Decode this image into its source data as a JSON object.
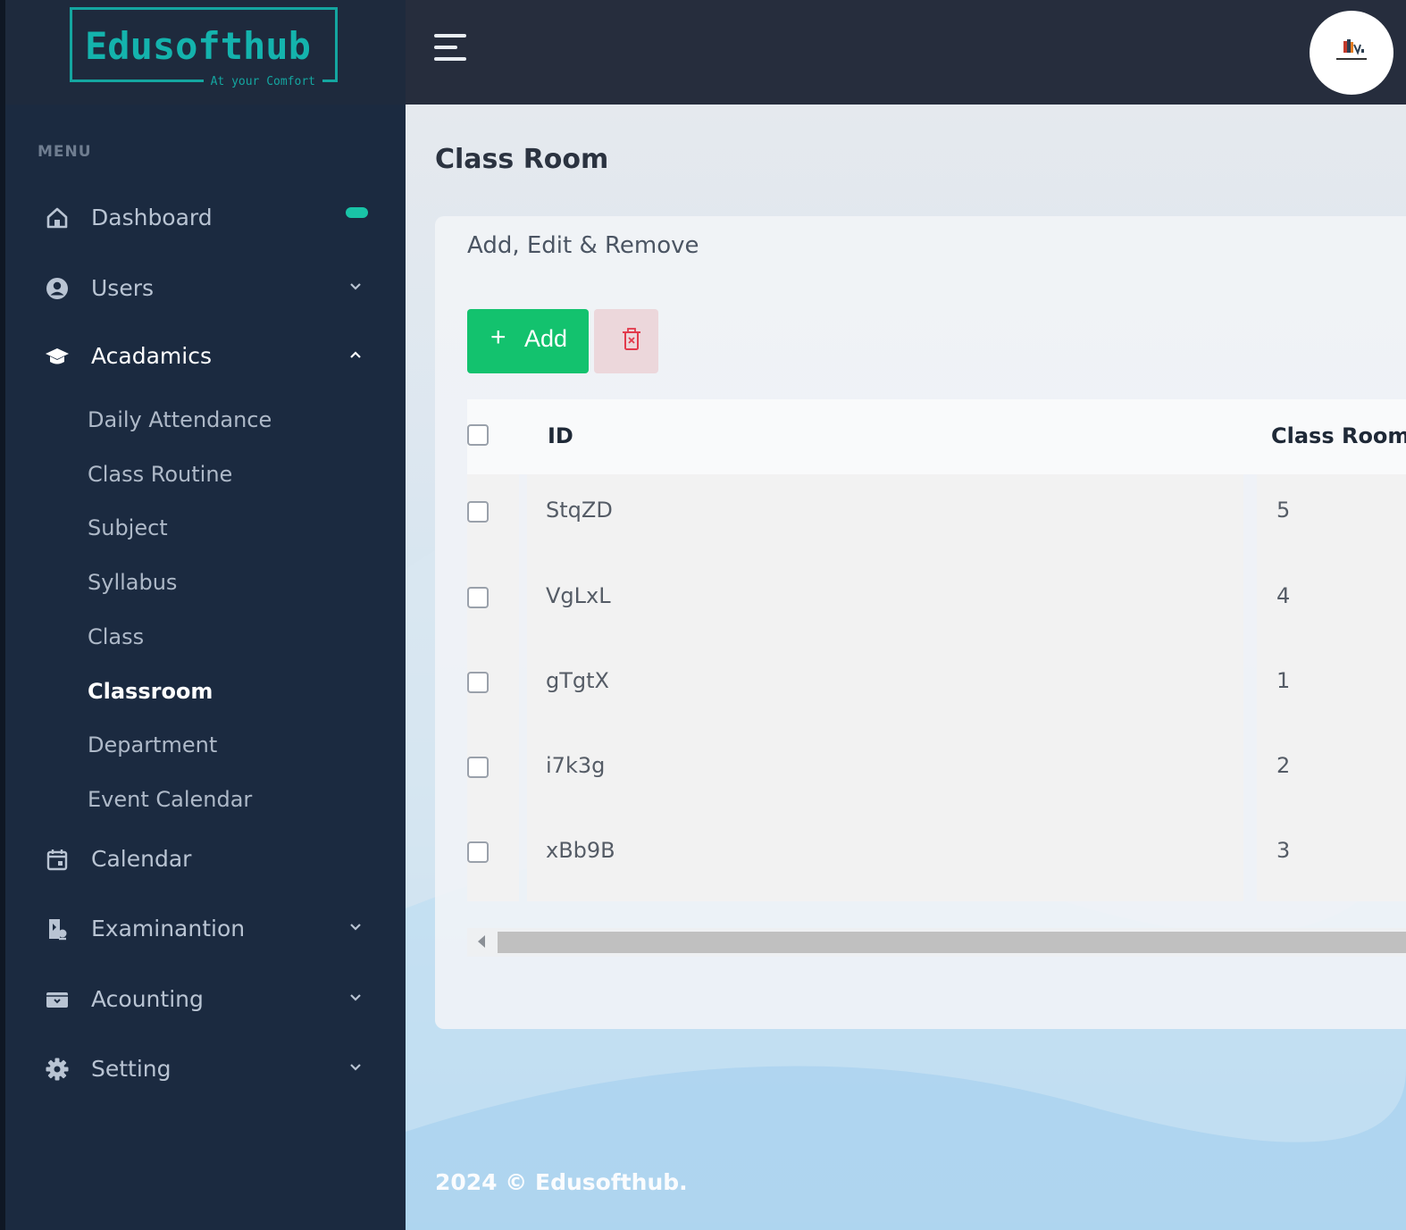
{
  "brand": {
    "name": "Edusofthub",
    "tagline": "At your Comfort"
  },
  "sidebar": {
    "menu_heading": "MENU",
    "items": [
      {
        "label": "Dashboard",
        "icon": "home-icon"
      },
      {
        "label": "Users",
        "icon": "user-circle-icon"
      },
      {
        "label": "Acadamics",
        "icon": "graduation-cap-icon"
      },
      {
        "label": "Calendar",
        "icon": "calendar-icon"
      },
      {
        "label": "Examinantion",
        "icon": "exam-icon"
      },
      {
        "label": "Acounting",
        "icon": "archive-icon"
      },
      {
        "label": "Setting",
        "icon": "gear-icon"
      }
    ],
    "sub_items": [
      {
        "label": "Daily Attendance"
      },
      {
        "label": "Class Routine"
      },
      {
        "label": "Subject"
      },
      {
        "label": "Syllabus"
      },
      {
        "label": "Class"
      },
      {
        "label": "Classroom"
      },
      {
        "label": "Department"
      },
      {
        "label": "Event Calendar"
      }
    ]
  },
  "page": {
    "title": "Class Room",
    "card_subtitle": "Add, Edit & Remove"
  },
  "toolbar": {
    "add_label": "Add",
    "add_icon": "+",
    "delete_icon": "trash-icon"
  },
  "table": {
    "headers": [
      "ID",
      "Class Room"
    ],
    "rows": [
      {
        "id": "StqZD",
        "classroom": "5"
      },
      {
        "id": "VgLxL",
        "classroom": "4"
      },
      {
        "id": "gTgtX",
        "classroom": "1"
      },
      {
        "id": "i7k3g",
        "classroom": "2"
      },
      {
        "id": "xBb9B",
        "classroom": "3"
      }
    ]
  },
  "footer": {
    "text": "2024 © Edusofthub."
  },
  "colors": {
    "sidebar_bg": "#1b2a40",
    "topbar_bg": "#262d3d",
    "accent": "#14a6a0",
    "add_button": "#13c26e",
    "delete_button_bg": "#ecd7db",
    "delete_icon": "#e23a4c"
  }
}
